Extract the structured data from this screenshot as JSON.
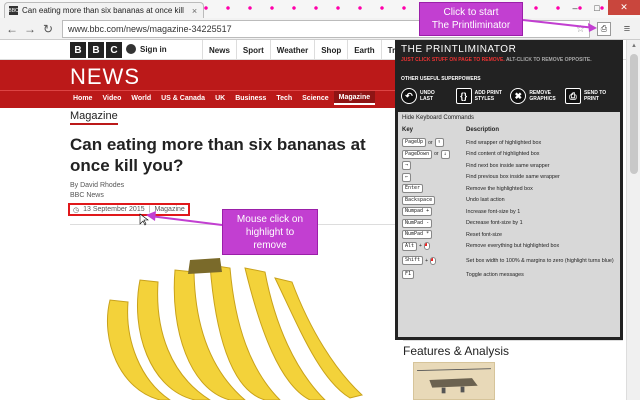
{
  "browser": {
    "tab_title": "Can eating more than six bananas at once kill",
    "tab_favicon": "BBC",
    "url": "www.bbc.com/news/magazine-34225517",
    "window_minimize": "–",
    "window_maximize": "□",
    "window_close": "✕",
    "ext_icon_glyph": "⎙",
    "menu_glyph": "≡"
  },
  "bbc": {
    "logo": [
      "B",
      "B",
      "C"
    ],
    "signin": "Sign in",
    "nav": [
      "News",
      "Sport",
      "Weather",
      "Shop",
      "Earth",
      "Tra"
    ],
    "news_logo": "NEWS",
    "news_nav": [
      "Home",
      "Video",
      "World",
      "US & Canada",
      "UK",
      "Business",
      "Tech",
      "Science",
      "Magazine"
    ],
    "active_nav": "Magazine",
    "section": "Magazine",
    "headline": "Can eating more than six bananas at once kill you?",
    "author": "By David Rhodes",
    "source": "BBC News",
    "date": "13 September 2015",
    "date_section": "Magazine",
    "features": "Features & Analysis"
  },
  "callouts": {
    "start_line1": "Click to start",
    "start_line2": "The Printliminator",
    "mouse_line1": "Mouse click on",
    "mouse_line2": "highlight to",
    "mouse_line3": "remove"
  },
  "printliminator": {
    "title": "THE PRINTLIMINATOR",
    "sub_main": "JUST CLICK STUFF ON PAGE TO REMOVE.",
    "sub_alt": "ALT-CLICK TO REMOVE OPPOSITE.",
    "useful": "OTHER USEFUL SUPERPOWERS",
    "buttons": [
      {
        "line1": "UNDO",
        "line2": "LAST",
        "icon": "↶"
      },
      {
        "line1": "ADD PRINT",
        "line2": "STYLES",
        "icon": "{}"
      },
      {
        "line1": "REMOVE",
        "line2": "GRAPHICS",
        "icon": "✖"
      },
      {
        "line1": "SEND TO",
        "line2": "PRINT",
        "icon": "⎙"
      }
    ],
    "hide_keys": "Hide Keyboard Commands",
    "col_key": "Key",
    "col_desc": "Description",
    "or": "or",
    "plus": "+",
    "rows": [
      {
        "k1": "PageUp",
        "k2": "↑",
        "desc": "Find wrapper of highlighted box"
      },
      {
        "k1": "PageDown",
        "k2": "↓",
        "desc": "Find content of highlighted box"
      },
      {
        "k1": "→",
        "desc": "Find next box inside same wrapper"
      },
      {
        "k1": "←",
        "desc": "Find previous box inside same wrapper"
      },
      {
        "k1": "Enter",
        "desc": "Remove the highlighted box"
      },
      {
        "k1": "Backspace",
        "desc": "Undo last action"
      },
      {
        "k1": "Numpad +",
        "desc": "Increase font-size by 1"
      },
      {
        "k1": "NumPad -",
        "desc": "Decrease font-size by 1"
      },
      {
        "k1": "NumPad *",
        "desc": "Reset font-size"
      },
      {
        "k1": "Alt",
        "desc": "Remove everything but highlighted box"
      },
      {
        "k1": "Shift",
        "desc": "Set box width to 100% & margins to zero (highlight turns blue)"
      },
      {
        "k1": "F1",
        "desc": "Toggle action messages"
      }
    ]
  },
  "colors": {
    "bbc_red": "#bb1919",
    "callout_purple": "#c23fd1",
    "highlight_red": "#e0181b"
  }
}
